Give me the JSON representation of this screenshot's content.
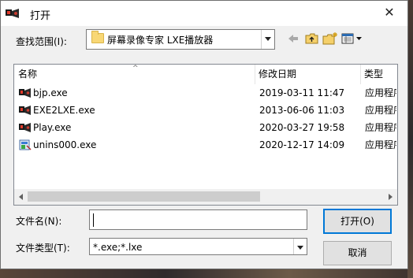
{
  "dialog": {
    "title": "打开",
    "close_glyph": "✕"
  },
  "lookin": {
    "label": "查找范围(I):",
    "value": "屏幕录像专家 LXE播放器"
  },
  "toolbar": {
    "icons": [
      "back-arrow-icon",
      "up-folder-icon",
      "new-folder-icon",
      "view-menu-icon"
    ]
  },
  "listview": {
    "columns": [
      "名称",
      "修改日期",
      "类型"
    ],
    "sort_glyph": "^",
    "files": [
      {
        "name": "bjp.exe",
        "modified": "2019-03-11 11:47",
        "type": "应用程序",
        "icon": "lxe-app-icon"
      },
      {
        "name": "EXE2LXE.exe",
        "modified": "2013-06-06 11:03",
        "type": "应用程序",
        "icon": "lxe-app-icon"
      },
      {
        "name": "Play.exe",
        "modified": "2020-03-27 19:58",
        "type": "应用程序",
        "icon": "lxe-app-icon"
      },
      {
        "name": "unins000.exe",
        "modified": "2020-12-17 14:09",
        "type": "应用程序",
        "icon": "uninstaller-icon"
      }
    ]
  },
  "filename": {
    "label": "文件名(N):",
    "value": ""
  },
  "filetype": {
    "label": "文件类型(T):",
    "value": "*.exe;*.lxe"
  },
  "buttons": {
    "open": "打开(O)",
    "cancel": "取消"
  },
  "colors": {
    "accent": "#0078d7",
    "window_bg": "#f0f0f0",
    "folder": "#f8d775"
  }
}
